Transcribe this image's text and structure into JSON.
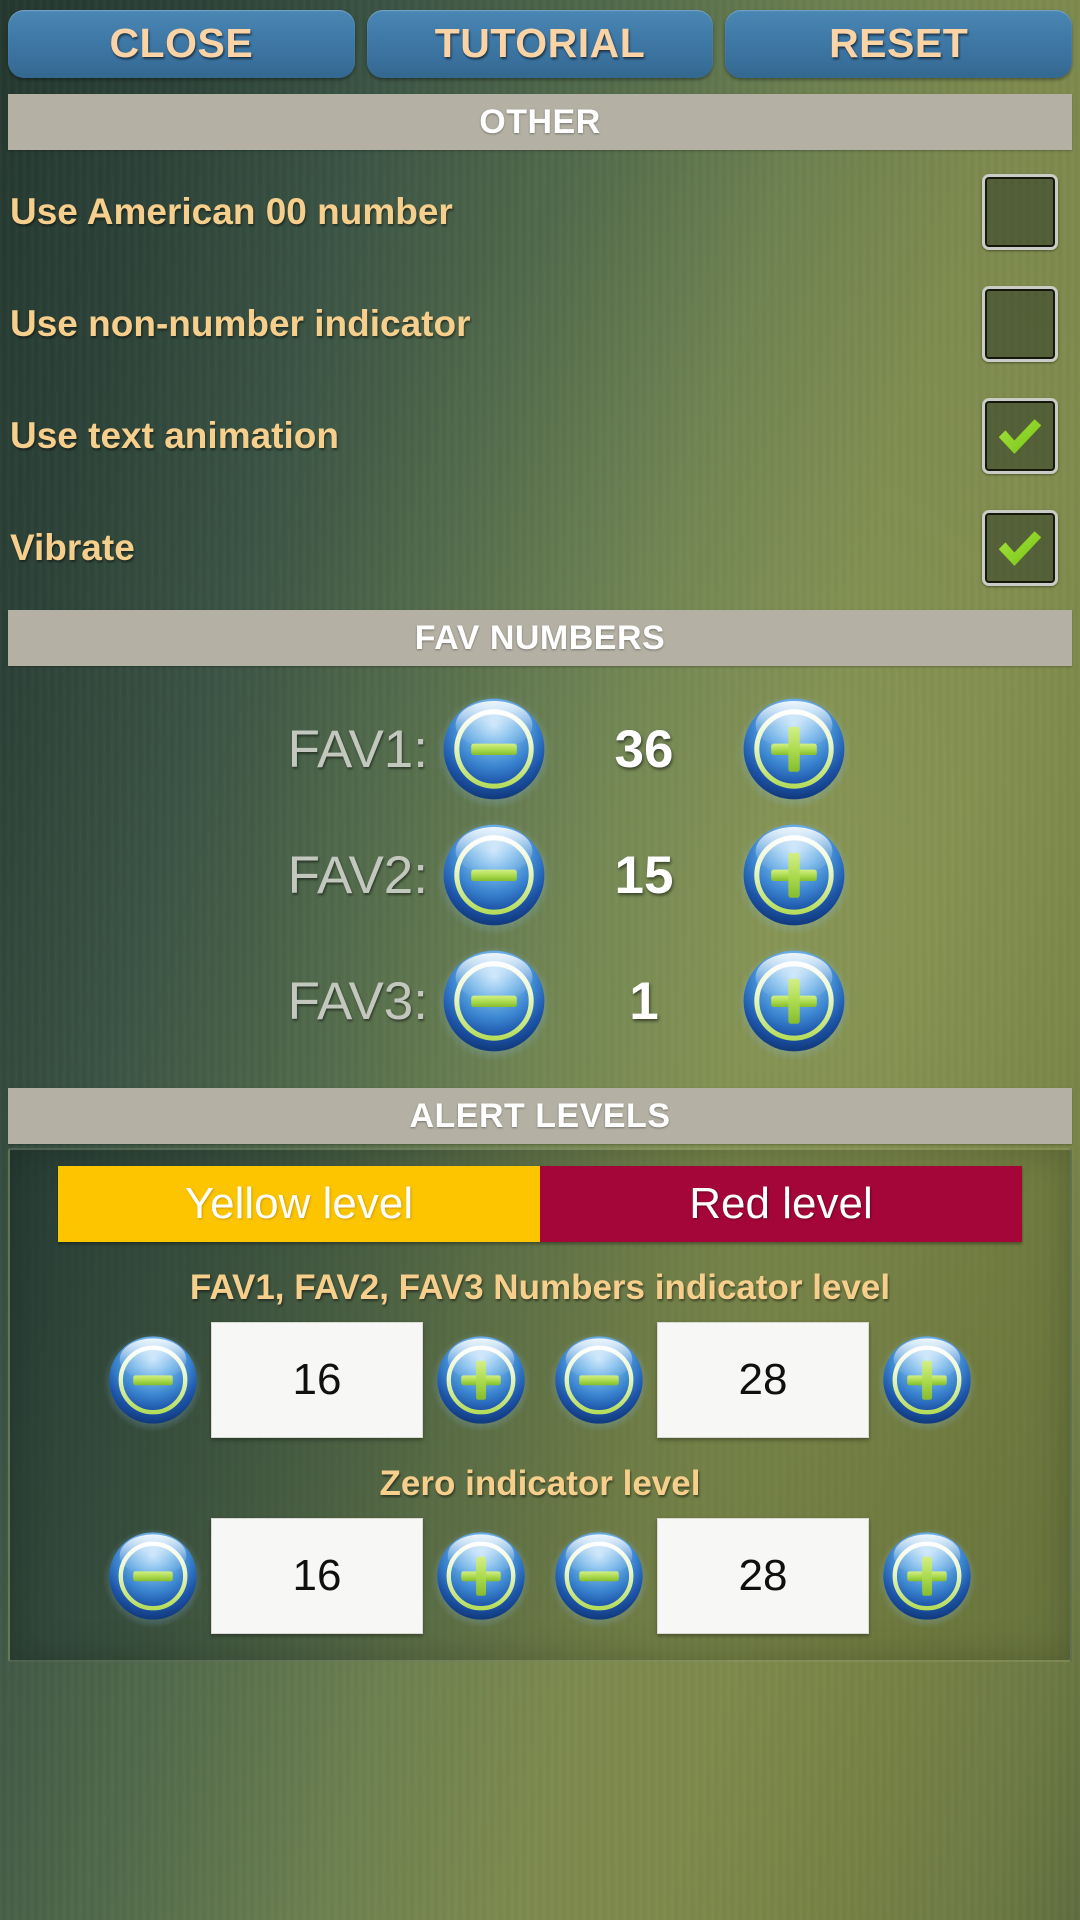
{
  "topbar": {
    "buttons": [
      {
        "label": "CLOSE",
        "name": "close-button"
      },
      {
        "label": "TUTORIAL",
        "name": "tutorial-button"
      },
      {
        "label": "RESET",
        "name": "reset-button"
      }
    ]
  },
  "sections": {
    "other": {
      "title": "OTHER"
    },
    "fav_numbers": {
      "title": "FAV NUMBERS"
    },
    "alert_levels": {
      "title": "ALERT LEVELS"
    }
  },
  "other_options": [
    {
      "label": "Use American 00 number",
      "checked": false
    },
    {
      "label": "Use non-number indicator",
      "checked": false
    },
    {
      "label": "Use text animation",
      "checked": true
    },
    {
      "label": "Vibrate",
      "checked": true
    }
  ],
  "fav_numbers": [
    {
      "label": "FAV1:",
      "value": "36"
    },
    {
      "label": "FAV2:",
      "value": "15"
    },
    {
      "label": "FAV3:",
      "value": "1"
    }
  ],
  "alert_levels": {
    "yellow_bar_label": "Yellow level",
    "red_bar_label": "Red level",
    "groups": [
      {
        "caption": "FAV1, FAV2, FAV3 Numbers indicator level",
        "yellow_value": "16",
        "red_value": "28"
      },
      {
        "caption": "Zero indicator level",
        "yellow_value": "16",
        "red_value": "28"
      }
    ]
  },
  "icons": {
    "minus": "minus-icon",
    "plus": "plus-icon",
    "check": "check-icon"
  },
  "colors": {
    "button_blue": "#3f7aa8",
    "button_text": "#fbd3a4",
    "section_header_bg": "#b4b1a4",
    "label_gold": "#f7cf8c",
    "yellow_level": "#fdc500",
    "red_level": "#a50639",
    "check_green": "#8ed320",
    "orb_blue": "#2f73c0",
    "orb_green": "#a6d94b"
  }
}
